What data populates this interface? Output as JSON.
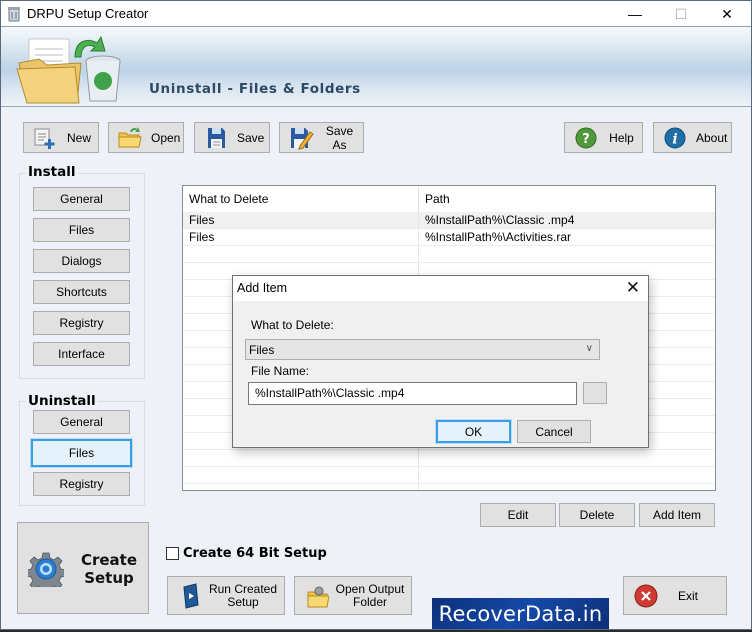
{
  "window": {
    "title": "DRPU Setup Creator",
    "controls": {
      "minimize": "—",
      "maximize": "☐",
      "close": "✕"
    }
  },
  "banner": {
    "heading": "Uninstall - Files & Folders",
    "logo_icon": "folder-recycle-bin-icon"
  },
  "toolbar": {
    "new_label": "New",
    "open_label": "Open",
    "save_label": "Save",
    "save_as_label": "Save As",
    "help_label": "Help",
    "about_label": "About"
  },
  "install_group": {
    "title": "Install",
    "items": [
      "General",
      "Files",
      "Dialogs",
      "Shortcuts",
      "Registry",
      "Interface"
    ]
  },
  "uninstall_group": {
    "title": "Uninstall",
    "items": [
      "General",
      "Files",
      "Registry"
    ],
    "selected": "Files"
  },
  "table": {
    "columns": [
      "What to Delete",
      "Path"
    ],
    "rows": [
      {
        "what": "Files",
        "path": "%InstallPath%\\Classic .mp4"
      },
      {
        "what": "Files",
        "path": "%InstallPath%\\Activities.rar"
      }
    ]
  },
  "actions": {
    "edit_label": "Edit",
    "delete_label": "Delete",
    "add_item_label": "Add Item"
  },
  "options": {
    "create_64bit_label": "Create 64 Bit Setup",
    "create_64bit_checked": false
  },
  "create_setup_label": "Create Setup",
  "bottom": {
    "run_setup_label": "Run Created Setup",
    "open_output_label": "Open Output Folder",
    "exit_label": "Exit",
    "brand": "RecoverData.in"
  },
  "dialog": {
    "title": "Add Item",
    "what_to_delete_label": "What to Delete:",
    "what_to_delete_value": "Files",
    "file_name_label": "File Name:",
    "file_name_value": "%InstallPath%\\Classic .mp4",
    "browse_label": "",
    "ok_label": "OK",
    "cancel_label": "Cancel"
  }
}
